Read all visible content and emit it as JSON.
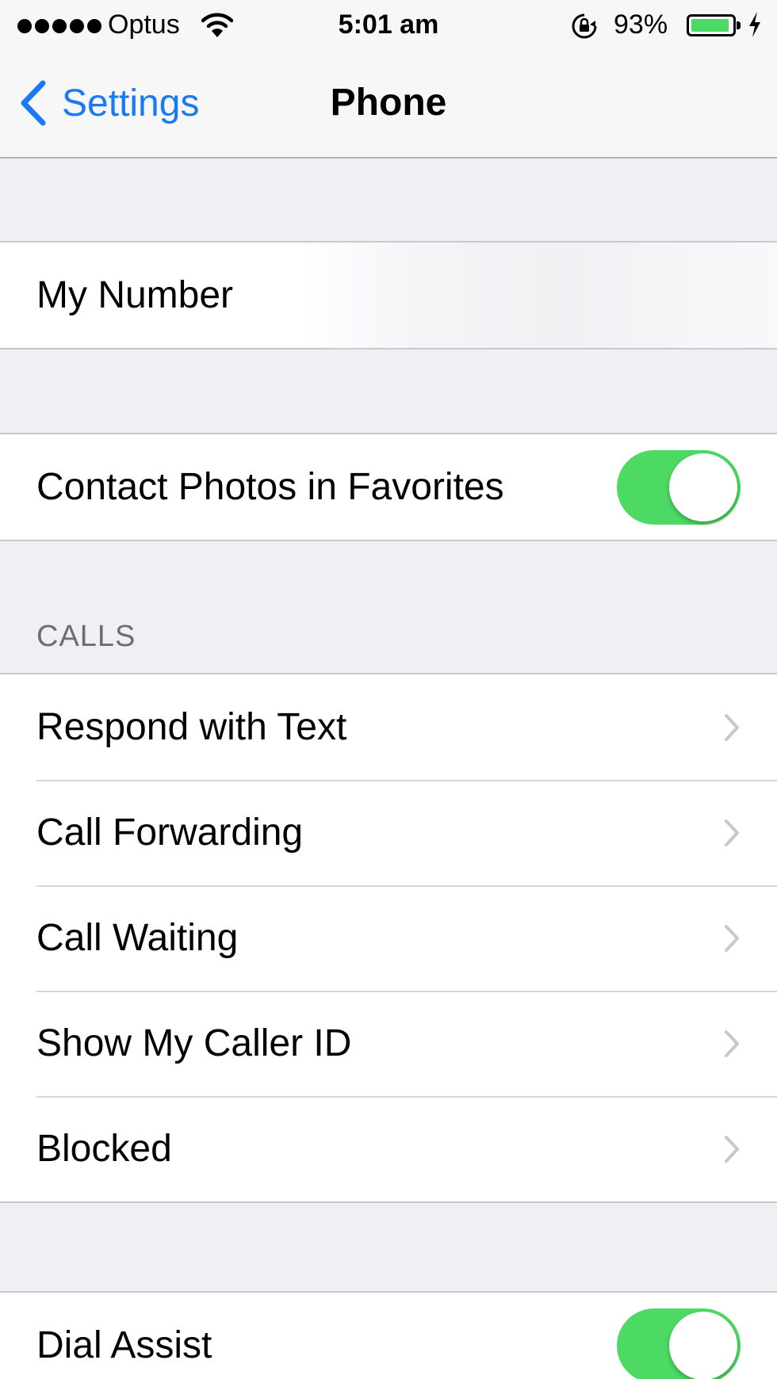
{
  "status_bar": {
    "carrier": "Optus",
    "time": "5:01 am",
    "battery_percent": "93%",
    "battery_level": 0.93,
    "icons": [
      "signal-dots-icon",
      "wifi-icon",
      "rotation-lock-icon",
      "battery-icon",
      "charging-bolt-icon"
    ]
  },
  "nav": {
    "back_label": "Settings",
    "title": "Phone"
  },
  "groups": {
    "my_number": {
      "label": "My Number"
    },
    "favorites": {
      "label": "Contact Photos in Favorites",
      "toggle_on": true
    },
    "calls": {
      "header": "CALLS",
      "items": [
        {
          "label": "Respond with Text"
        },
        {
          "label": "Call Forwarding"
        },
        {
          "label": "Call Waiting"
        },
        {
          "label": "Show My Caller ID"
        },
        {
          "label": "Blocked"
        }
      ]
    },
    "dial_assist": {
      "label": "Dial Assist",
      "toggle_on": true
    }
  },
  "colors": {
    "accent": "#1a7af5",
    "toggle_on": "#4cd964",
    "group_bg": "#efeff4",
    "section_header": "#6d6d72"
  }
}
